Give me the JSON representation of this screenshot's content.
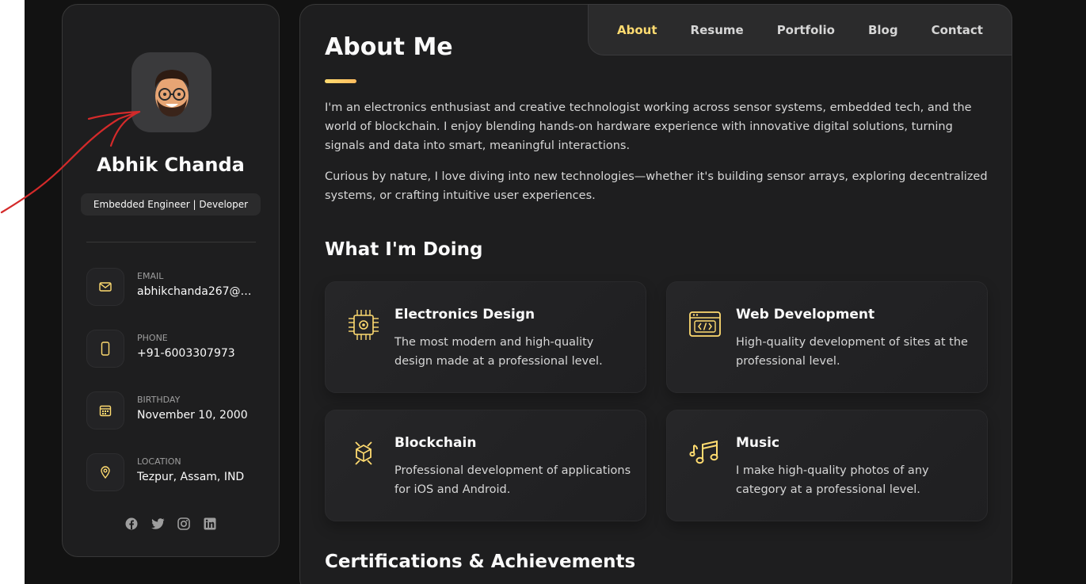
{
  "sidebar": {
    "name": "Abhik Chanda",
    "title": "Embedded Engineer | Developer",
    "contacts": [
      {
        "label": "EMAIL",
        "value": "abhikchanda267@g...",
        "icon": "mail-icon"
      },
      {
        "label": "PHONE",
        "value": "+91-6003307973",
        "icon": "phone-icon"
      },
      {
        "label": "BIRTHDAY",
        "value": "November 10, 2000",
        "icon": "calendar-icon"
      },
      {
        "label": "LOCATION",
        "value": "Tezpur, Assam, IND",
        "icon": "location-icon"
      }
    ],
    "socials": [
      "facebook-icon",
      "twitter-icon",
      "instagram-icon",
      "linkedin-icon"
    ]
  },
  "nav": {
    "items": [
      "About",
      "Resume",
      "Portfolio",
      "Blog",
      "Contact"
    ],
    "active": "About"
  },
  "about": {
    "heading": "About Me",
    "paragraphs": [
      "I'm an electronics enthusiast and creative technologist working across sensor systems, embedded tech, and the world of blockchain. I enjoy blending hands-on hardware experience with innovative digital solutions, turning signals and data into smart, meaningful interactions.",
      "Curious by nature, I love diving into new technologies—whether it's building sensor arrays, exploring decentralized systems, or crafting intuitive user experiences."
    ]
  },
  "services": {
    "heading": "What I'm Doing",
    "items": [
      {
        "title": "Electronics Design",
        "text": "The most modern and high-quality design made at a professional level.",
        "icon": "chip-icon"
      },
      {
        "title": "Web Development",
        "text": "High-quality development of sites at the professional level.",
        "icon": "code-window-icon"
      },
      {
        "title": "Blockchain",
        "text": "Professional development of applications for iOS and Android.",
        "icon": "blockchain-icon"
      },
      {
        "title": "Music",
        "text": "I make high-quality photos of any category at a professional level.",
        "icon": "music-icon"
      }
    ]
  },
  "certifications": {
    "heading": "Certifications & Achievements"
  },
  "colors": {
    "accent": "#ffdb70",
    "background": "#121212",
    "card": "#1e1e1f",
    "annotation": "#d42a2a"
  }
}
